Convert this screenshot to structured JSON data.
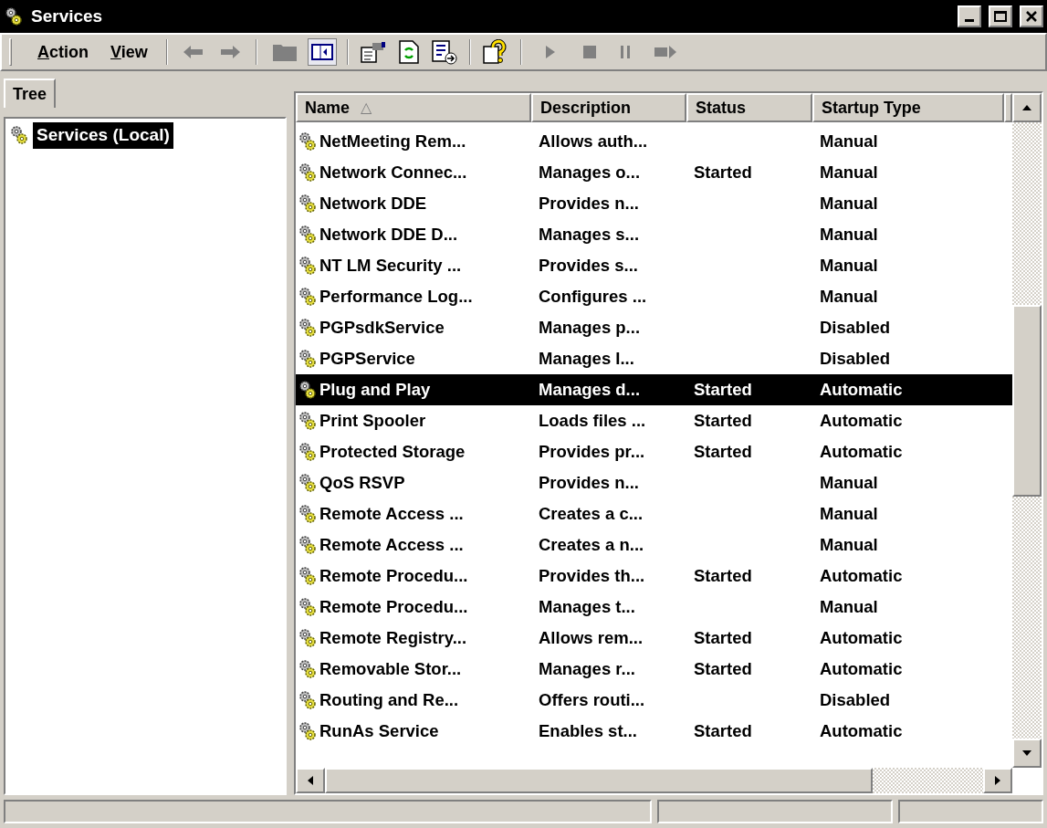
{
  "window": {
    "title": "Services"
  },
  "menu": [
    {
      "label": "Action"
    },
    {
      "label": "View"
    }
  ],
  "tree": {
    "tab": "Tree",
    "items": [
      {
        "label": "Services (Local)",
        "selected": true
      }
    ]
  },
  "table": {
    "columns": [
      {
        "label": "Name",
        "sort": "△"
      },
      {
        "label": "Description"
      },
      {
        "label": "Status"
      },
      {
        "label": "Startup Type"
      }
    ],
    "rows": [
      {
        "cells": [
          "NetMeeting Rem...",
          "Allows auth...",
          "",
          "Manual"
        ],
        "selected": false
      },
      {
        "cells": [
          "Network Connec...",
          "Manages o...",
          "Started",
          "Manual"
        ],
        "selected": false
      },
      {
        "cells": [
          "Network DDE",
          "Provides n...",
          "",
          "Manual"
        ],
        "selected": false
      },
      {
        "cells": [
          "Network DDE D...",
          "Manages s...",
          "",
          "Manual"
        ],
        "selected": false
      },
      {
        "cells": [
          "NT LM Security ...",
          "Provides s...",
          "",
          "Manual"
        ],
        "selected": false
      },
      {
        "cells": [
          "Performance Log...",
          "Configures ...",
          "",
          "Manual"
        ],
        "selected": false
      },
      {
        "cells": [
          "PGPsdkService",
          "Manages p...",
          "",
          "Disabled"
        ],
        "selected": false
      },
      {
        "cells": [
          "PGPService",
          "Manages I...",
          "",
          "Disabled"
        ],
        "selected": false
      },
      {
        "cells": [
          "Plug and Play",
          "Manages d...",
          "Started",
          "Automatic"
        ],
        "selected": true
      },
      {
        "cells": [
          "Print Spooler",
          "Loads files ...",
          "Started",
          "Automatic"
        ],
        "selected": false
      },
      {
        "cells": [
          "Protected Storage",
          "Provides pr...",
          "Started",
          "Automatic"
        ],
        "selected": false
      },
      {
        "cells": [
          "QoS RSVP",
          "Provides n...",
          "",
          "Manual"
        ],
        "selected": false
      },
      {
        "cells": [
          "Remote Access ...",
          "Creates a c...",
          "",
          "Manual"
        ],
        "selected": false
      },
      {
        "cells": [
          "Remote Access ...",
          "Creates a n...",
          "",
          "Manual"
        ],
        "selected": false
      },
      {
        "cells": [
          "Remote Procedu...",
          "Provides th...",
          "Started",
          "Automatic"
        ],
        "selected": false
      },
      {
        "cells": [
          "Remote Procedu...",
          "Manages t...",
          "",
          "Manual"
        ],
        "selected": false
      },
      {
        "cells": [
          "Remote Registry...",
          "Allows rem...",
          "Started",
          "Automatic"
        ],
        "selected": false
      },
      {
        "cells": [
          "Removable Stor...",
          "Manages r...",
          "Started",
          "Automatic"
        ],
        "selected": false
      },
      {
        "cells": [
          "Routing and Re...",
          "Offers routi...",
          "",
          "Disabled"
        ],
        "selected": false
      },
      {
        "cells": [
          "RunAs Service",
          "Enables st...",
          "Started",
          "Automatic"
        ],
        "selected": false
      }
    ]
  }
}
